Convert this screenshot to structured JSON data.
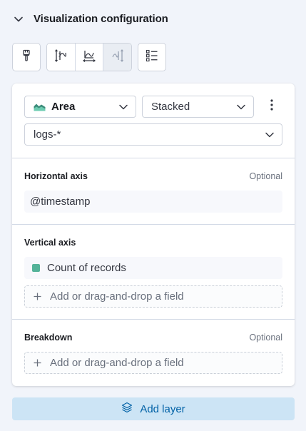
{
  "config": {
    "title": "Visualization configuration"
  },
  "toolbar": {
    "buttons": [
      {
        "name": "appearance-icon"
      },
      {
        "name": "left-axis-icon"
      },
      {
        "name": "bottom-axis-icon"
      },
      {
        "name": "right-axis-icon"
      },
      {
        "name": "legend-icon"
      }
    ]
  },
  "layer": {
    "chart_type": "Area",
    "stack_mode": "Stacked",
    "data_view": "logs-*",
    "horizontal_axis": {
      "title": "Horizontal axis",
      "optional": "Optional",
      "field": "@timestamp"
    },
    "vertical_axis": {
      "title": "Vertical axis",
      "field": "Count of records",
      "field_color": "#54b399",
      "add_placeholder": "Add or drag-and-drop a field"
    },
    "breakdown": {
      "title": "Breakdown",
      "optional": "Optional",
      "add_placeholder": "Add or drag-and-drop a field"
    }
  },
  "add_layer": {
    "label": "Add layer"
  },
  "colors": {
    "accent": "#0061a6",
    "add_layer_bg": "#cce4f5",
    "series": "#54b399"
  }
}
